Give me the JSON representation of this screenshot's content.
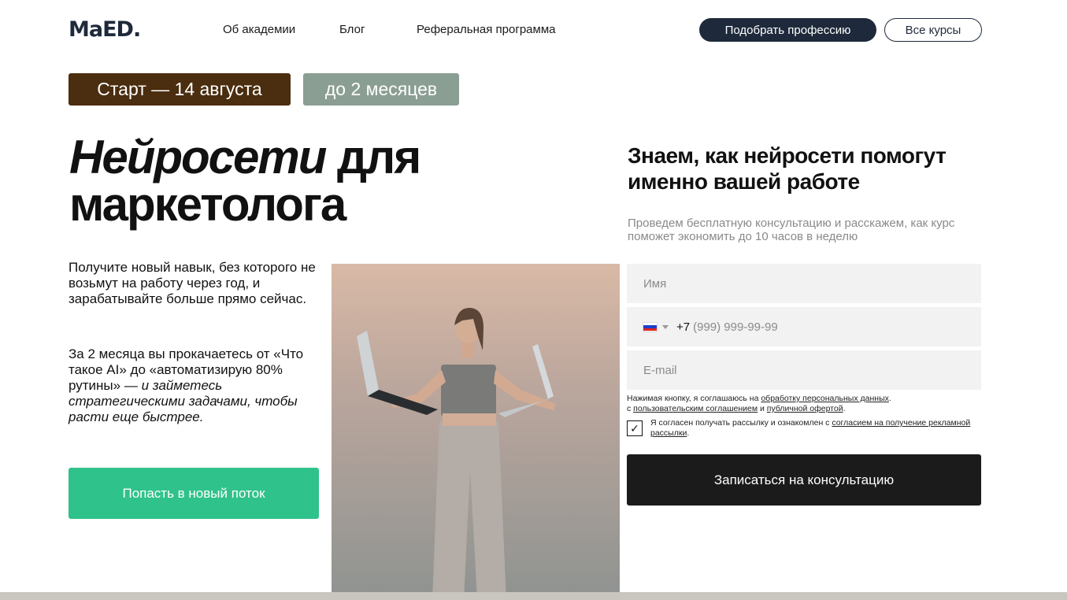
{
  "header": {
    "logo": "MaED.",
    "nav": [
      "Об академии",
      "Блог",
      "Реферальная программа"
    ],
    "primary_button": "Подобрать профессию",
    "secondary_button": "Все курсы"
  },
  "badges": {
    "start": "Старт —  14 августа",
    "duration": "до 2 месяцев"
  },
  "hero": {
    "title_italic": "Нейросети",
    "title_rest": " для маркетолога",
    "lead": "Получите новый навык, без которого не возьмут на работу через год, и зарабатывайте больше прямо сейчас.",
    "lead2_plain": "За 2 месяца вы прокачаетесь от «Что такое AI» до «автоматизирую 80% рутины» — ",
    "lead2_italic": "и займетесь стратегическими задачами, чтобы расти еще быстрее.",
    "cta": "Попасть в новый поток"
  },
  "form": {
    "title": "Знаем, как нейросети помогут именно вашей работе",
    "subtitle": "Проведем бесплатную консультацию и расскажем, как курс поможет экономить до 10 часов в неделю",
    "name_placeholder": "Имя",
    "phone_prefix": "+7",
    "phone_placeholder": "(999) 999-99-99",
    "email_placeholder": "E-mail",
    "consent_text_1": "Нажимая кнопку, я соглашаюсь на ",
    "consent_link_1": "обработку персональных данных",
    "consent_text_2": ".",
    "consent_text_3": "с ",
    "consent_link_2": "пользовательским соглашением",
    "consent_text_4": " и ",
    "consent_link_3": "публичной офертой",
    "consent_text_5": ".",
    "newsletter_text": "Я согласен получать рассылку и ознакомлен с ",
    "newsletter_link": "согласием на получение рекламной рассылки",
    "newsletter_end": ".",
    "submit": "Записаться на консультацию"
  },
  "icons": {
    "flag": "russia-flag-icon",
    "checkbox": "check-icon"
  },
  "colors": {
    "brand_dark": "#1e2a3b",
    "start_badge": "#4b2d0f",
    "duration_badge": "#8b9e93",
    "cta_green": "#30c28b",
    "submit_black": "#1b1b1b"
  }
}
